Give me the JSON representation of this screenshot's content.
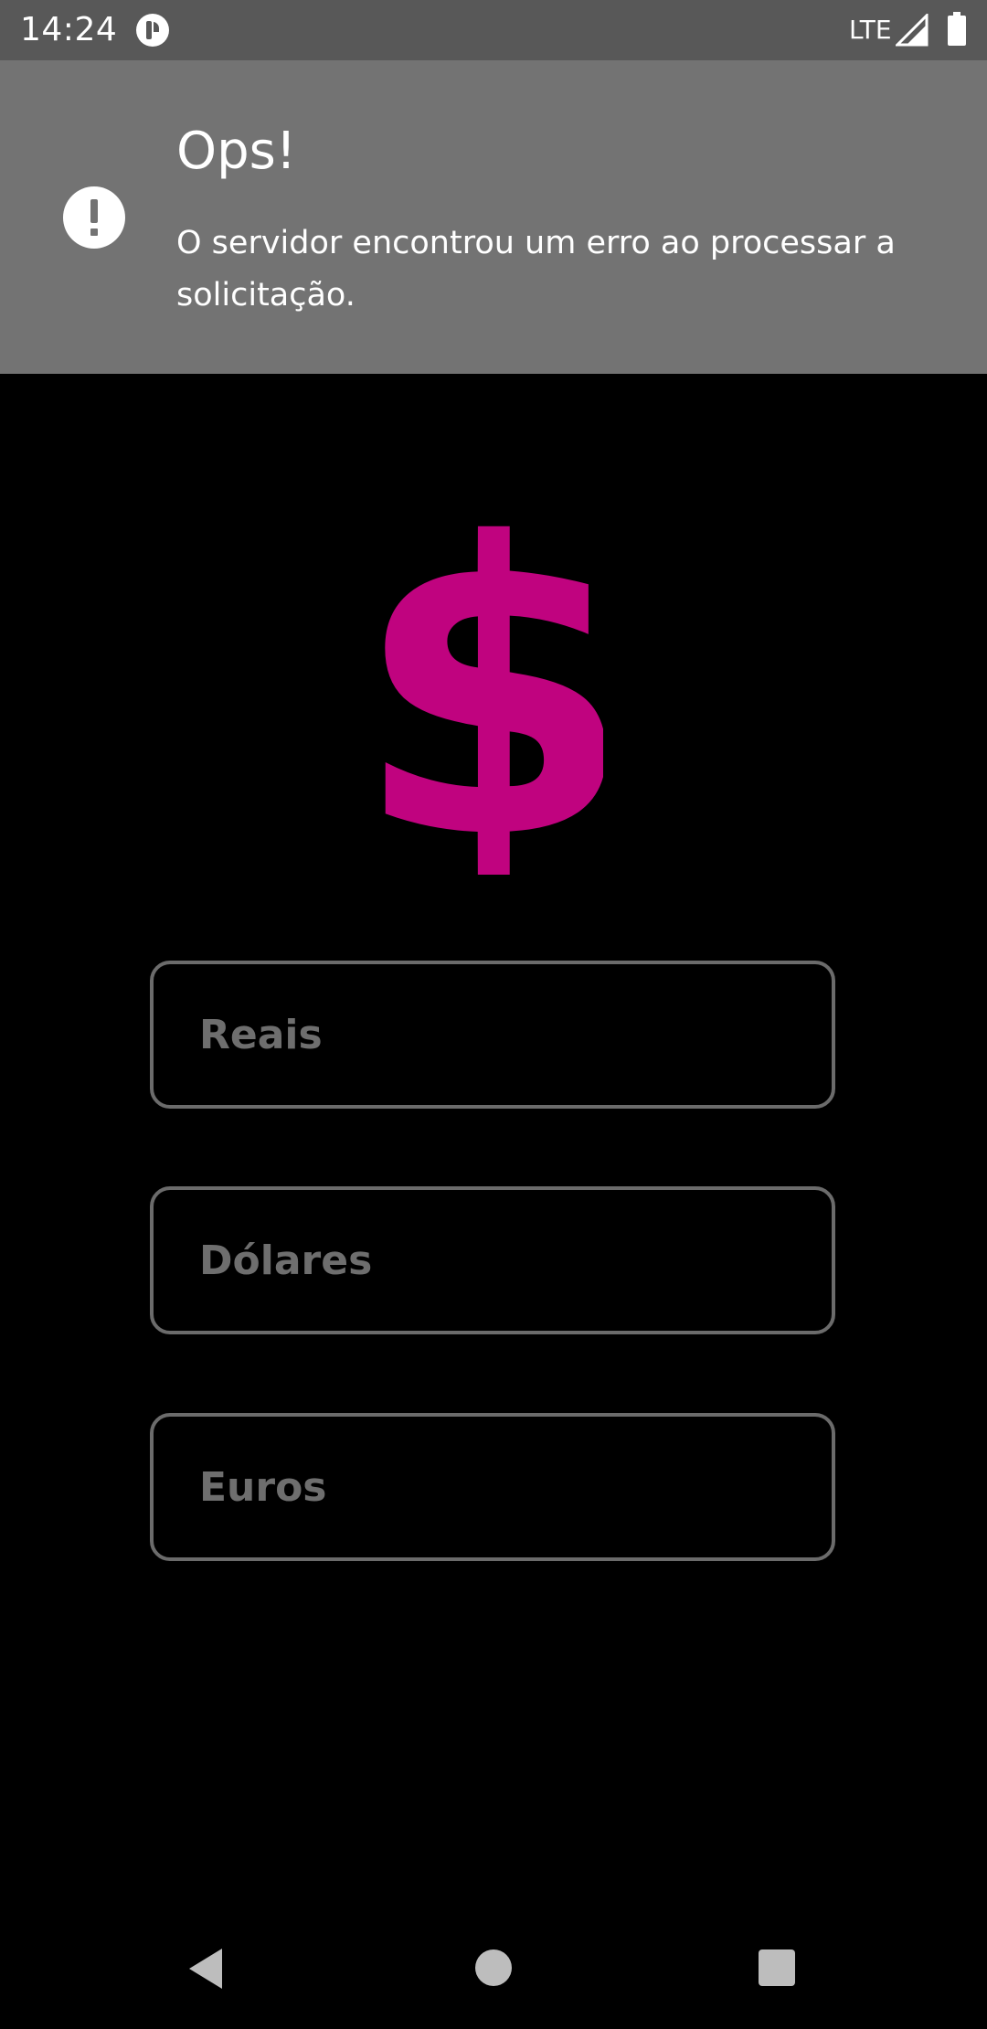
{
  "status_bar": {
    "time": "14:24",
    "network": "LTE",
    "icons": [
      "app-notification-icon",
      "signal-icon",
      "battery-icon"
    ]
  },
  "error_banner": {
    "title": "Ops!",
    "message": "O servidor encontrou um erro ao processar a solicitação.",
    "icon": "alert-icon"
  },
  "logo": {
    "icon": "dollar-sign-icon",
    "color": "#c0037f"
  },
  "inputs": [
    {
      "placeholder": "Reais",
      "value": ""
    },
    {
      "placeholder": "Dólares",
      "value": ""
    },
    {
      "placeholder": "Euros",
      "value": ""
    }
  ],
  "nav_bar": {
    "icons": [
      "back-icon",
      "home-icon",
      "recents-icon"
    ]
  },
  "colors": {
    "background": "#000000",
    "banner": "#737373",
    "accent": "#c0037f",
    "field_border": "#6b6b6b"
  }
}
